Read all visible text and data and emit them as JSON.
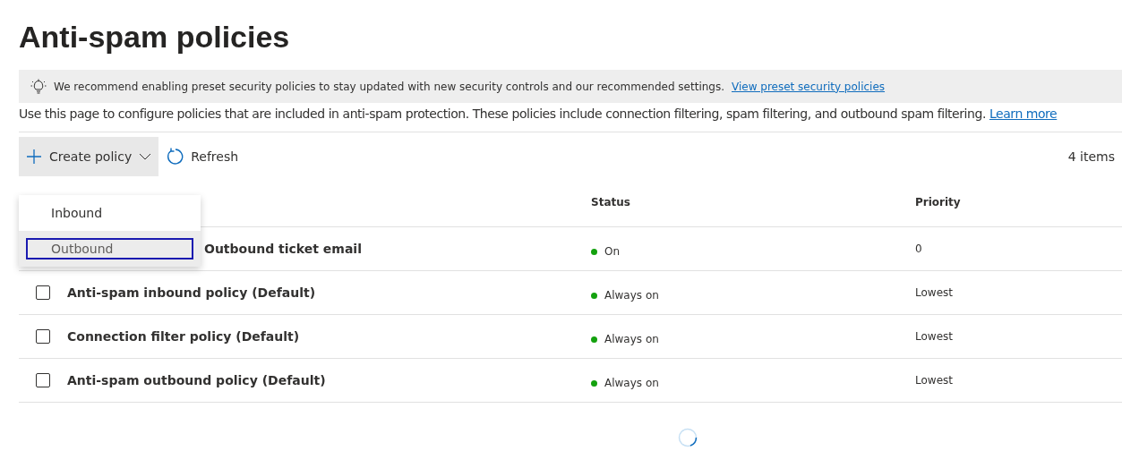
{
  "page": {
    "title": "Anti-spam policies"
  },
  "banner": {
    "text": "We recommend enabling preset security policies to stay updated with new security controls and our recommended settings.",
    "link": "View preset security policies"
  },
  "description": {
    "text": "Use this page to configure policies that are included in anti-spam protection. These policies include connection filtering, spam filtering, and outbound spam filtering.",
    "link": "Learn more"
  },
  "toolbar": {
    "create": "Create policy",
    "refresh": "Refresh",
    "count": "4 items"
  },
  "menu": {
    "items": [
      {
        "label": "Inbound",
        "selected": false
      },
      {
        "label": "Outbound",
        "selected": true
      }
    ]
  },
  "table": {
    "columns": [
      "Status",
      "Priority"
    ],
    "rows": [
      {
        "name": "Outbound ticket email",
        "status": "On",
        "priority": "0"
      },
      {
        "name": "Anti-spam inbound policy (Default)",
        "status": "Always on",
        "priority": "Lowest",
        "checked": false
      },
      {
        "name": "Connection filter policy (Default)",
        "status": "Always on",
        "priority": "Lowest",
        "checked": false
      },
      {
        "name": "Anti-spam outbound policy (Default)",
        "status": "Always on",
        "priority": "Lowest",
        "checked": false
      }
    ]
  }
}
